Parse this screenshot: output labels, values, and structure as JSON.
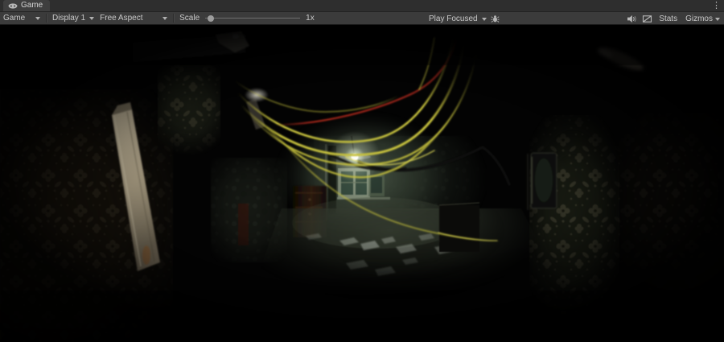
{
  "tab_bar": {
    "tab": {
      "icon": "game-view-icon",
      "label": "Game"
    },
    "menu_icon": "⋮"
  },
  "toolbar": {
    "game_dropdown": "Game",
    "display_dropdown": "Display 1",
    "aspect_dropdown": "Free Aspect",
    "scale_label": "Scale",
    "scale_value": "1x",
    "play_focused_dropdown": "Play Focused",
    "stats_button": "Stats",
    "gizmos_button": "Gizmos",
    "icons": [
      "bug-icon",
      "mute-audio-icon",
      "slashed-frame-icon",
      "chevron-down-icon"
    ]
  },
  "scene": {
    "name": "game-viewport",
    "content_icons": [
      "light-bulb",
      "hanging-cables",
      "floral-wallpaper",
      "wooden-plank",
      "window-frame"
    ]
  },
  "colors": {
    "tabbar_bg": "#2e2e2e",
    "toolbar_bg": "#3b3b3b",
    "tab_bg": "#3f3f3f",
    "chrome_text": "#c8c8c8",
    "chrome_border": "#232323",
    "icon_gray": "#b5b5b5",
    "scene_bg": "#030303",
    "cable_yellow": "#c6c13c",
    "cable_yellow_bright": "#e8e25a",
    "cable_red": "#9c2418",
    "bulb_core": "#ffffff",
    "bulb_glow": "#e9f7d8",
    "wallpaper_motif": "#8d8164",
    "wallpaper_tint_left": "#4a3b26",
    "wallpaper_tint_green": "#39402c",
    "window_frame": "#9aa78f",
    "window_pane": "#3c5244",
    "hall_wall_light": "#4c5a4a",
    "floor": "#2e342a",
    "plank_light": "#c9bda1",
    "plank_dark": "#6f6654",
    "dresser_brown": "#3a2413",
    "debris": "#aab2a6"
  }
}
